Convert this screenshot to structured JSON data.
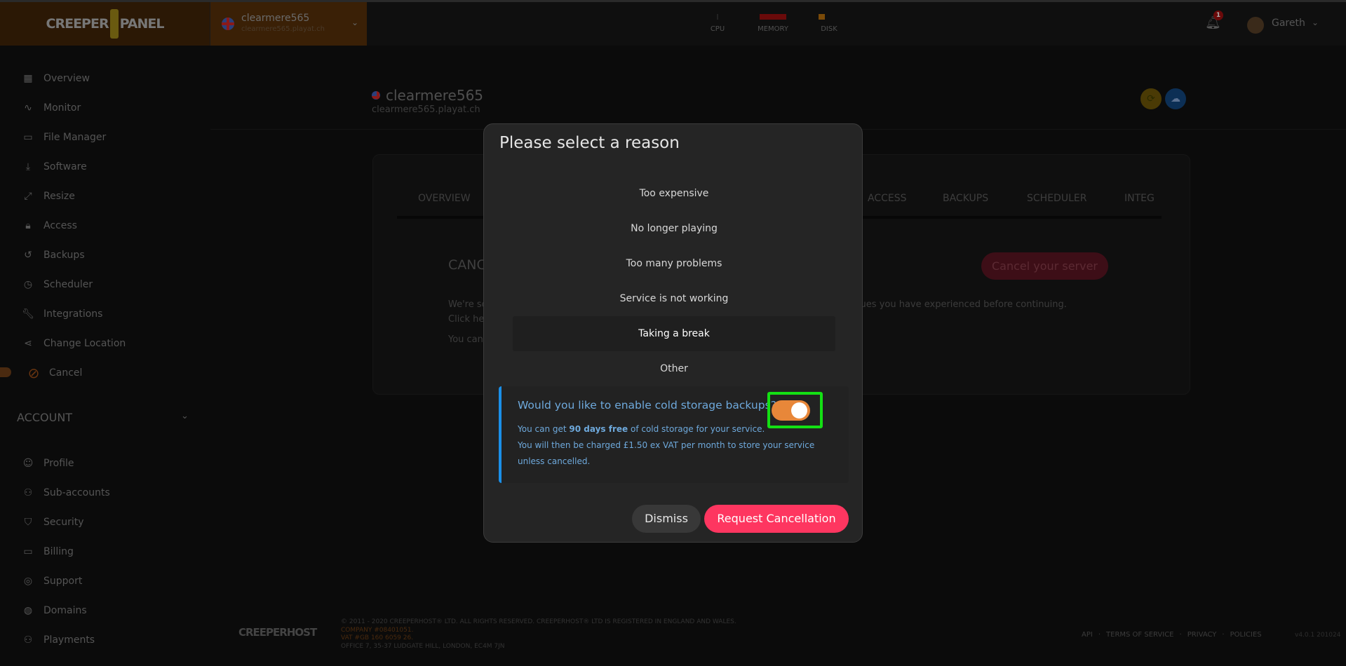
{
  "header": {
    "logo": "CREEPERPANEL",
    "server_name": "clearmere565",
    "server_host": "clearmere565.playat.ch",
    "meters": [
      {
        "label": "CPU",
        "color": "#222222"
      },
      {
        "label": "MEMORY",
        "color": "#6a0a0a"
      },
      {
        "label": "DISK",
        "color": "#7a4a08"
      }
    ],
    "notifications": "1",
    "user": "Gareth"
  },
  "sidebar": {
    "items": [
      {
        "label": "Overview",
        "icon": "grid-icon"
      },
      {
        "label": "Monitor",
        "icon": "activity-icon"
      },
      {
        "label": "File Manager",
        "icon": "folder-icon"
      },
      {
        "label": "Software",
        "icon": "download-icon"
      },
      {
        "label": "Resize",
        "icon": "expand-icon"
      },
      {
        "label": "Access",
        "icon": "lock-icon"
      },
      {
        "label": "Backups",
        "icon": "rotate-icon"
      },
      {
        "label": "Scheduler",
        "icon": "clock-icon"
      },
      {
        "label": "Integrations",
        "icon": "wrench-icon"
      },
      {
        "label": "Change Location",
        "icon": "share-icon"
      },
      {
        "label": "Cancel",
        "icon": "ban-icon"
      }
    ],
    "account_label": "ACCOUNT",
    "account_items": [
      {
        "label": "Profile",
        "icon": "user-icon"
      },
      {
        "label": "Sub-accounts",
        "icon": "users-icon"
      },
      {
        "label": "Security",
        "icon": "shield-icon"
      },
      {
        "label": "Billing",
        "icon": "credit-card-icon"
      },
      {
        "label": "Support",
        "icon": "lifebuoy-icon"
      },
      {
        "label": "Domains",
        "icon": "globe-icon"
      },
      {
        "label": "Playments",
        "icon": "users-icon"
      }
    ]
  },
  "main": {
    "server_name": "clearmere565",
    "server_host": "clearmere565.playat.ch",
    "tabs": [
      "OVERVIEW",
      "ACCESS",
      "BACKUPS",
      "SCHEDULER",
      "INTEG"
    ],
    "section_title": "CANC",
    "cancel_button": "Cancel your server",
    "lines": [
      "We're so",
      "ssues you have experienced before continuing.",
      "Click he",
      "You can"
    ]
  },
  "modal": {
    "title": "Please select a reason",
    "reasons": [
      "Too expensive",
      "No longer playing",
      "Too many problems",
      "Service is not working",
      "Taking a break",
      "Other"
    ],
    "selected": "Taking a break",
    "info": {
      "question": "Would you like to enable cold storage backups?",
      "line1_pre": "You can get ",
      "line1_bold": "90 days free",
      "line1_post": " of cold storage for your service.",
      "line2": "You will then be charged £1.50 ex VAT per month to store your service unless cancelled.",
      "toggle_on": true
    },
    "dismiss": "Dismiss",
    "request": "Request Cancellation"
  },
  "footer": {
    "logo": "CREEPERHOST",
    "copyright": "© 2011 - 2020 CREEPERHOST® LTD. ALL RIGHTS RESERVED. CREEPERHOST® LTD IS REGISTERED IN ENGLAND AND WALES.",
    "company": "COMPANY #08401051.",
    "vat": "VAT #GB 160 6059 26.",
    "address": "OFFICE 7, 35-37 LUDGATE HILL, LONDON, EC4M 7JN",
    "links": [
      "API",
      "TERMS OF SERVICE",
      "PRIVACY",
      "POLICIES"
    ],
    "version": "v4.0.1 201024"
  }
}
